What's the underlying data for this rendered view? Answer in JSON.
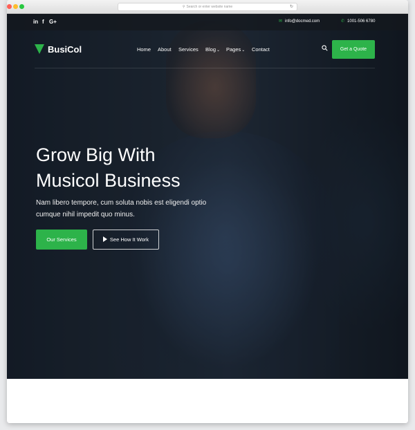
{
  "browser": {
    "address_placeholder": "Search or enter website name"
  },
  "topbar": {
    "social": [
      "in",
      "f",
      "G+"
    ],
    "email": "info@docmed.com",
    "phone": "1001-506 6780"
  },
  "nav": {
    "logo_text": "BusiCol",
    "menu": [
      "Home",
      "About",
      "Services",
      "Blog",
      "Pages",
      "Contact"
    ],
    "quote_button": "Get a Quote"
  },
  "hero": {
    "headline_line1": "Grow Big With",
    "headline_line2": "Musicol Business",
    "subtext_line1": "Nam libero tempore, cum soluta nobis est eligendi optio",
    "subtext_line2": "cumque nihil impedit quo minus.",
    "primary_button": "Our Services",
    "secondary_button": "See How It Work"
  },
  "colors": {
    "accent": "#2db34a",
    "hero_dark": "#1a2430"
  },
  "icons": {
    "search": "search-icon",
    "email": "mail-icon",
    "phone": "phone-icon",
    "play": "play-icon"
  }
}
